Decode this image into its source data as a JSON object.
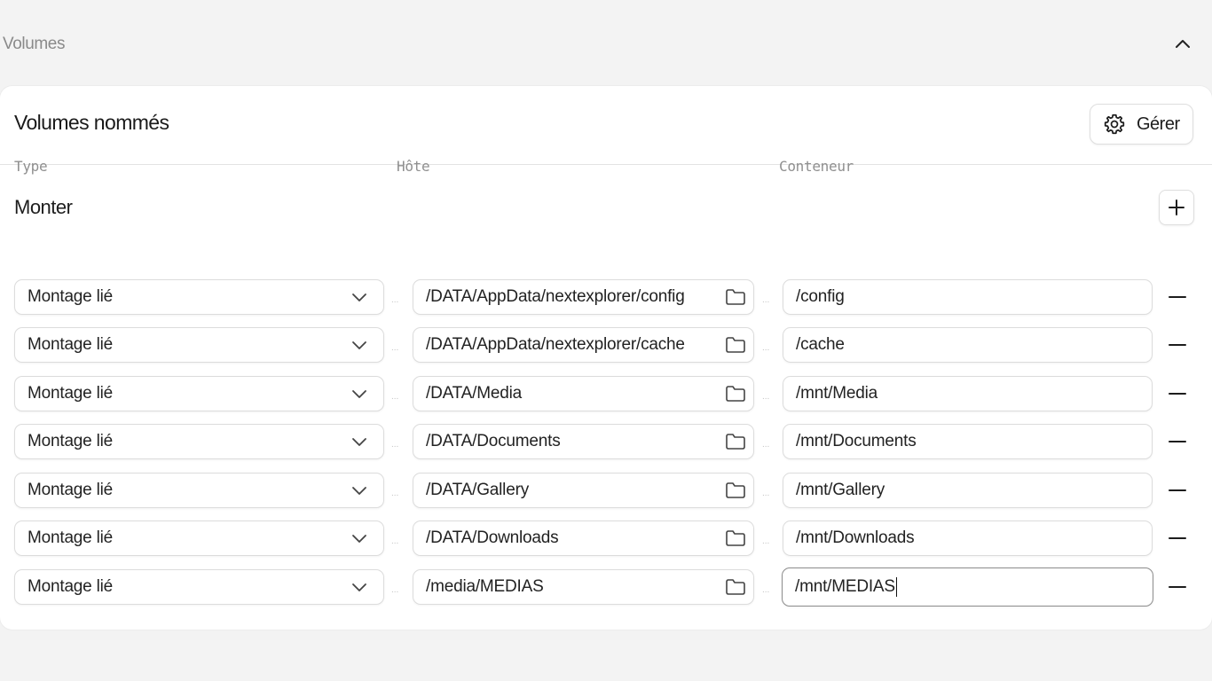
{
  "section": {
    "title": "Volumes",
    "collapse_icon": "chevron-up-icon"
  },
  "named_volumes": {
    "title": "Volumes nommés",
    "manage_label": "Gérer",
    "manage_icon": "gear-icon"
  },
  "mount": {
    "title": "Monter",
    "add_icon": "plus-icon",
    "columns": {
      "type": "Type",
      "host": "Hôte",
      "container": "Conteneur"
    },
    "separator": "...",
    "rows": [
      {
        "type": "Montage lié",
        "host": "/DATA/AppData/nextexplorer/config",
        "container": "/config"
      },
      {
        "type": "Montage lié",
        "host": "/DATA/AppData/nextexplorer/cache",
        "container": "/cache"
      },
      {
        "type": "Montage lié",
        "host": "/DATA/Media",
        "container": "/mnt/Media"
      },
      {
        "type": "Montage lié",
        "host": "/DATA/Documents",
        "container": "/mnt/Documents"
      },
      {
        "type": "Montage lié",
        "host": "/DATA/Gallery",
        "container": "/mnt/Gallery"
      },
      {
        "type": "Montage lié",
        "host": "/DATA/Downloads",
        "container": "/mnt/Downloads"
      },
      {
        "type": "Montage lié",
        "host": "/media/MEDIAS",
        "container": "/mnt/MEDIAS"
      }
    ]
  },
  "colors": {
    "background": "#f3f3f3",
    "card": "#ffffff",
    "border": "#dcdcdc",
    "muted": "#8f8f8f"
  }
}
